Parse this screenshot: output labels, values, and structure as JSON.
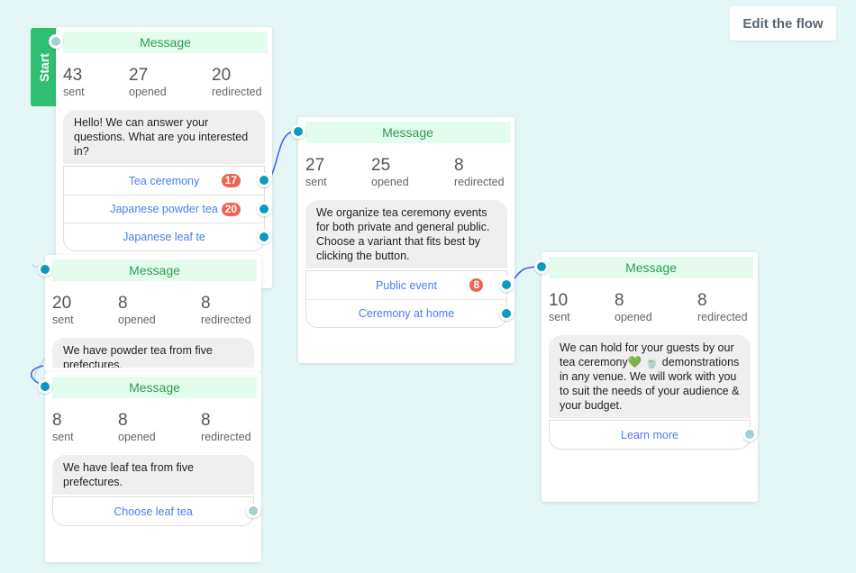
{
  "toolbar": {
    "edit_label": "Edit the flow"
  },
  "start_label": "Start",
  "cards": [
    {
      "title": "Message",
      "stats": [
        {
          "n": "43",
          "l": "sent"
        },
        {
          "n": "27",
          "l": "opened"
        },
        {
          "n": "20",
          "l": "redirected"
        }
      ],
      "text": "Hello! We can answer your questions. What are you interested in?",
      "buttons": [
        {
          "label": "Tea ceremony",
          "badge": "17"
        },
        {
          "label": "Japanese powder tea",
          "badge": "20"
        },
        {
          "label": "Japanese leaf te",
          "badge": null
        }
      ]
    },
    {
      "title": "Message",
      "stats": [
        {
          "n": "20",
          "l": "sent"
        },
        {
          "n": "8",
          "l": "opened"
        },
        {
          "n": "8",
          "l": "redirected"
        }
      ],
      "text": "We have powder tea from five prefectures.",
      "buttons": []
    },
    {
      "title": "Message",
      "stats": [
        {
          "n": "8",
          "l": "sent"
        },
        {
          "n": "8",
          "l": "opened"
        },
        {
          "n": "8",
          "l": "redirected"
        }
      ],
      "text": "We have leaf tea from five prefectures.",
      "buttons": [
        {
          "label": "Choose leaf tea",
          "badge": null,
          "inactive": true
        }
      ]
    },
    {
      "title": "Message",
      "stats": [
        {
          "n": "27",
          "l": "sent"
        },
        {
          "n": "25",
          "l": "opened"
        },
        {
          "n": "8",
          "l": "redirected"
        }
      ],
      "text": "We organize tea ceremony events for both private and general public. Choose a variant that fits best by clicking the button.",
      "buttons": [
        {
          "label": "Public event",
          "badge": "8"
        },
        {
          "label": "Ceremony at home",
          "badge": null
        }
      ]
    },
    {
      "title": "Message",
      "stats": [
        {
          "n": "10",
          "l": "sent"
        },
        {
          "n": "8",
          "l": "opened"
        },
        {
          "n": "8",
          "l": "redirected"
        }
      ],
      "text": "We can hold for your guests by our tea ceremony💚 🍵 demonstrations in any venue. We will work with you to suit the needs of your audience & your budget.",
      "buttons": [
        {
          "label": "Learn more",
          "badge": null,
          "inactive": true
        }
      ]
    }
  ],
  "colors": {
    "accent": "#0a9bc2",
    "header_bg": "#e4fcee",
    "header_text": "#2e9c4f",
    "badge": "#ee6352",
    "start": "#2fbf71"
  }
}
